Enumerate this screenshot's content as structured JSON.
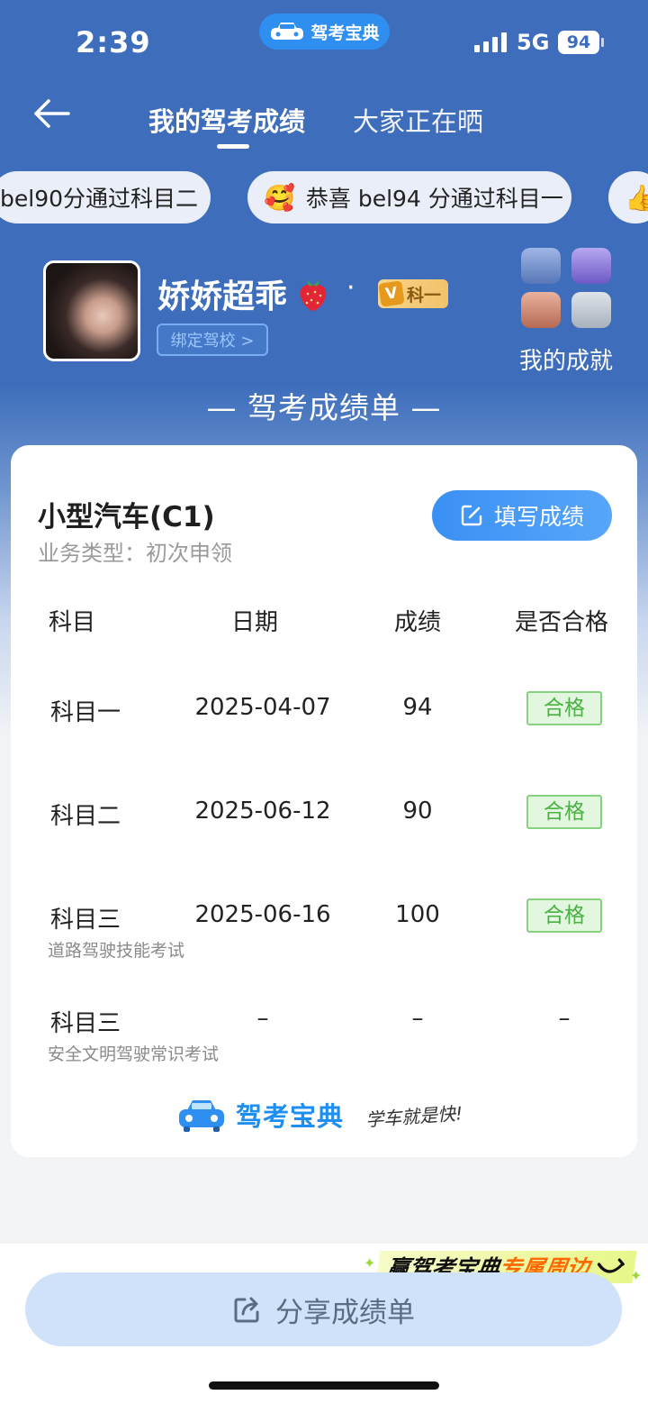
{
  "status_bar": {
    "time": "2:39",
    "app_badge": "驾考宝典",
    "network": "5G",
    "battery": "94"
  },
  "header": {
    "tab_mine": "我的驾考成绩",
    "tab_others": "大家正在晒"
  },
  "ticker": [
    {
      "text": "bel90分通过科目二"
    },
    {
      "emoji": "🥰",
      "text": "恭喜 bel94 分通过科目一"
    },
    {
      "emoji": "👍",
      "text": ""
    }
  ],
  "profile": {
    "username": "娇娇超乖",
    "separator": "·",
    "vip_letter": "V",
    "vip_level": "科一",
    "bind_school": "绑定驾校 >",
    "achievements_label": "我的成就"
  },
  "report_title": "— 驾考成绩单 —",
  "card": {
    "license": "小型汽车(C1)",
    "business_type": "业务类型：初次申领",
    "fill_button": "填写成绩",
    "headers": {
      "subject": "科目",
      "date": "日期",
      "score": "成绩",
      "pass": "是否合格"
    },
    "rows": [
      {
        "subject": "科目一",
        "note": "",
        "date": "2025-04-07",
        "score": "94",
        "pass": "合格"
      },
      {
        "subject": "科目二",
        "note": "",
        "date": "2025-06-12",
        "score": "90",
        "pass": "合格"
      },
      {
        "subject": "科目三",
        "note": "道路驾驶技能考试",
        "date": "2025-06-16",
        "score": "100",
        "pass": "合格"
      },
      {
        "subject": "科目三",
        "note": "安全文明驾驶常识考试",
        "date": "–",
        "score": "–",
        "pass": "–"
      }
    ],
    "brand_name": "驾考宝典",
    "brand_slogan": "学车就是快!"
  },
  "promo": {
    "part1": "赢驾考宝典",
    "part2": "专属周边"
  },
  "share_button": "分享成绩单",
  "colors": {
    "header_blue": "#3d6dbb",
    "accent_blue": "#3a90f3",
    "pass_green": "#49b243",
    "promo_orange": "#ff6a00"
  }
}
